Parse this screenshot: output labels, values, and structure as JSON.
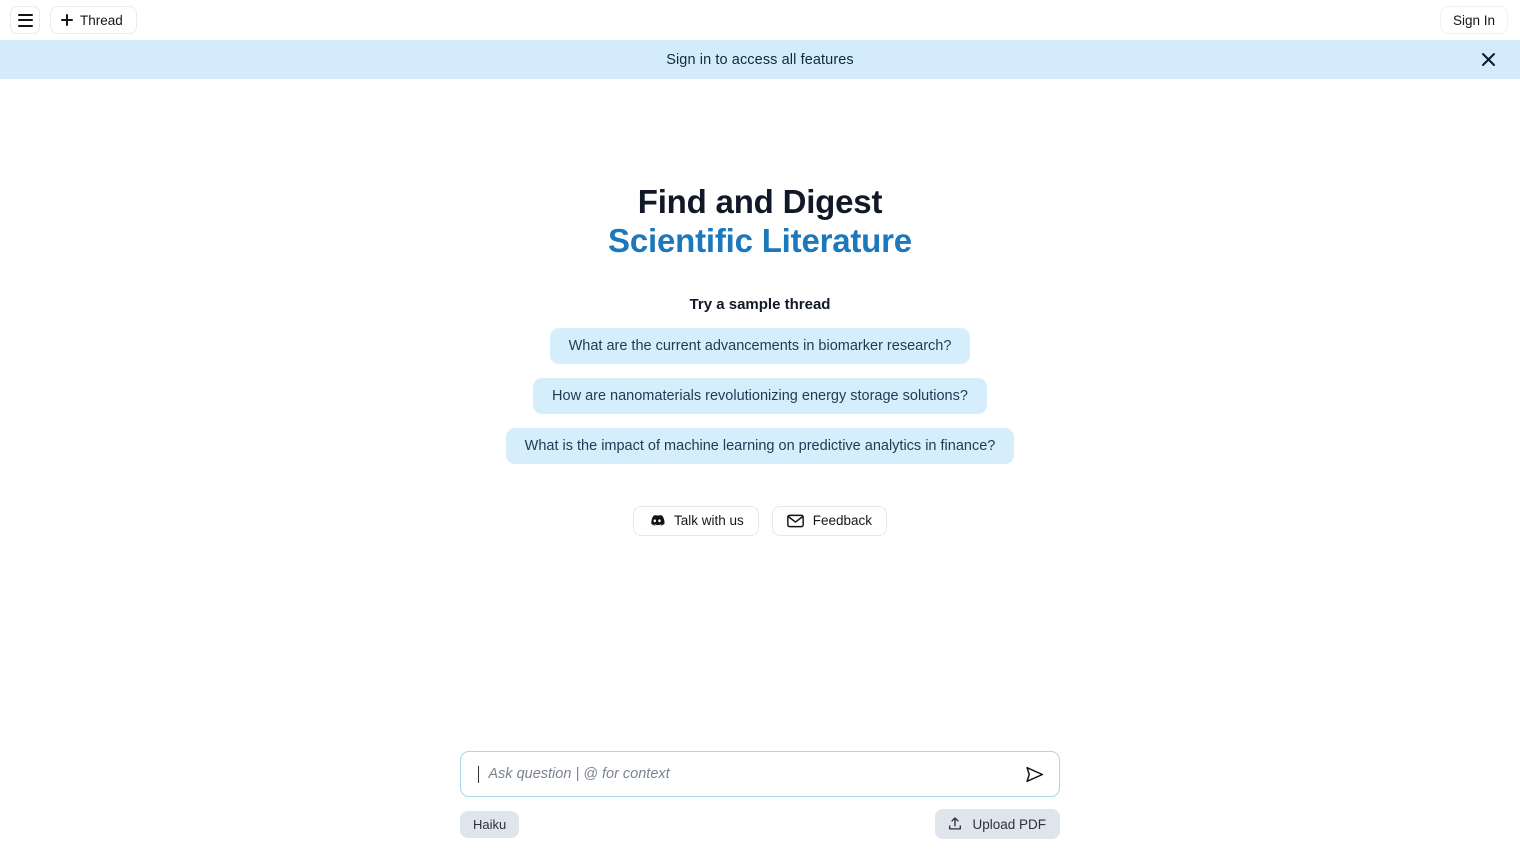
{
  "topbar": {
    "menu_icon": "hamburger-menu-icon",
    "new_thread_label": "Thread",
    "new_thread_icon": "plus-icon",
    "sign_in_label": "Sign In"
  },
  "banner": {
    "message": "Sign in to access all features",
    "close_icon": "close-icon",
    "background_color": "#d4ebfb",
    "text_color": "#0f2a3d"
  },
  "hero": {
    "line1": "Find and Digest",
    "line2": "Scientific Literature",
    "line1_color": "#111827",
    "line2_color": "#1b78bd"
  },
  "samples": {
    "label": "Try a sample thread",
    "chip_background": "#d6eefb",
    "chip_text_color": "#1d3b52",
    "items": [
      {
        "label": "What are the current advancements in biomarker research?"
      },
      {
        "label": "How are nanomaterials revolutionizing energy storage solutions?"
      },
      {
        "label": "What is the impact of machine learning on predictive analytics in finance?"
      }
    ]
  },
  "links": [
    {
      "label": "Talk with us",
      "icon": "discord-icon"
    },
    {
      "label": "Feedback",
      "icon": "mail-icon"
    }
  ],
  "composer": {
    "input_value": "",
    "placeholder": "Ask question | @ for context",
    "send_icon": "send-icon",
    "border_color": "#a9d7ef",
    "model_label": "Haiku",
    "upload_label": "Upload PDF",
    "upload_icon": "upload-icon"
  }
}
